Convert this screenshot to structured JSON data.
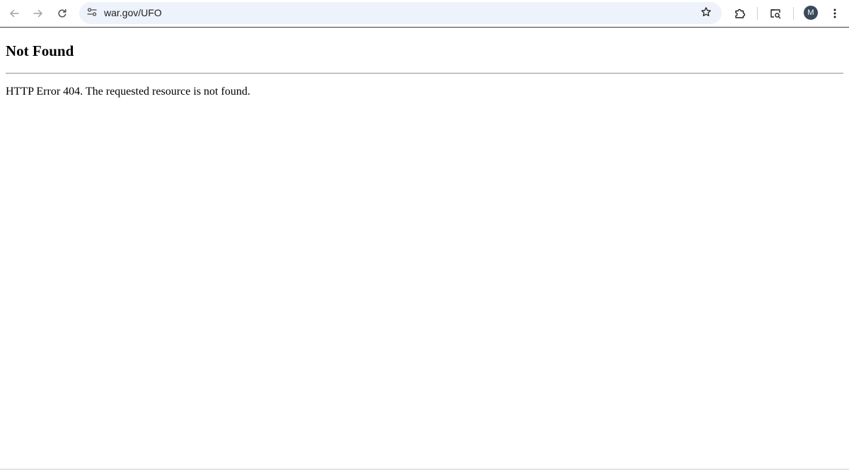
{
  "browser": {
    "back_icon": "arrow-left-icon",
    "forward_icon": "arrow-right-icon",
    "reload_icon": "reload-icon",
    "site_info_icon": "tune-icon",
    "address": "war.gov/UFO",
    "bookmark_icon": "star-outline-icon",
    "extensions_icon": "puzzle-icon",
    "reading_mode_icon": "reading-mode-icon",
    "profile_initial": "M",
    "menu_icon": "vertical-dots-icon",
    "colors": {
      "omnibox_bg": "#eef2fb",
      "avatar_bg": "#3b4a5a",
      "icon": "#474747"
    }
  },
  "page": {
    "title": "Not Found",
    "message": "HTTP Error 404. The requested resource is not found."
  }
}
